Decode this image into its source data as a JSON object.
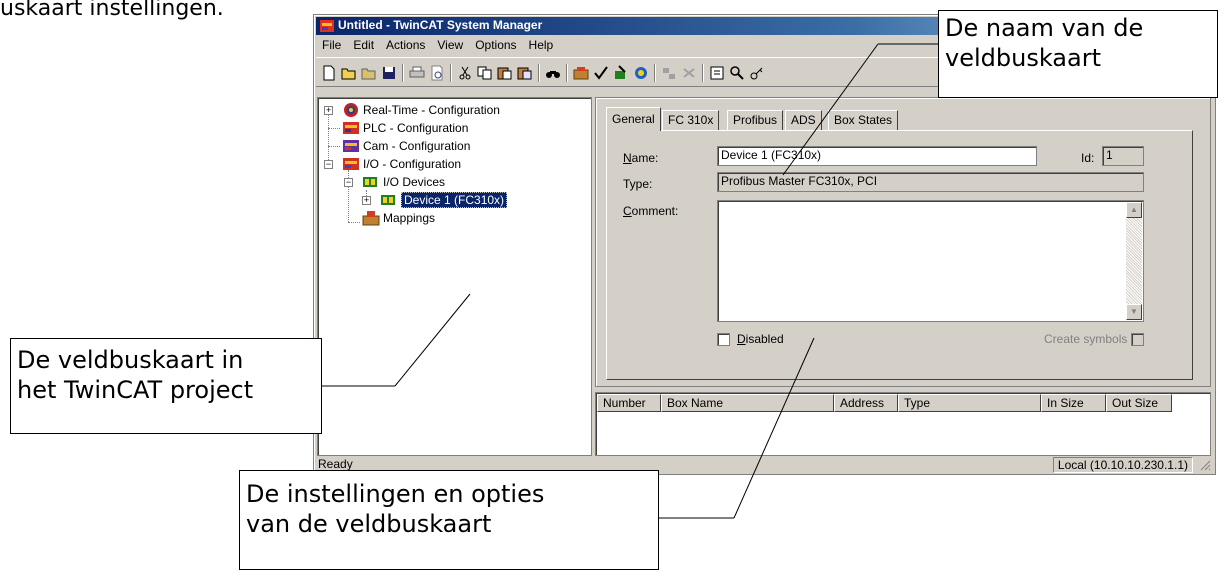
{
  "caption": "uskaart instellingen.",
  "window": {
    "title": "Untitled - TwinCAT System Manager",
    "menu": [
      "File",
      "Edit",
      "Actions",
      "View",
      "Options",
      "Help"
    ],
    "status_left": "Ready",
    "status_right": "Local (10.10.10.230.1.1)"
  },
  "tree": {
    "realtime": "Real-Time - Configuration",
    "plc": "PLC - Configuration",
    "cam": "Cam - Configuration",
    "io": "I/O - Configuration",
    "io_devices": "I/O Devices",
    "device1": "Device 1 (FC310x)",
    "mappings": "Mappings"
  },
  "tabs": [
    "General",
    "FC 310x",
    "Profibus",
    "ADS",
    "Box States"
  ],
  "general": {
    "name_label": "Name:",
    "name_value": "Device 1 (FC310x)",
    "id_label": "Id:",
    "id_value": "1",
    "type_label": "Type:",
    "type_value": "Profibus Master FC310x, PCI",
    "comment_label": "Comment:",
    "comment_value": "",
    "disabled_label": "Disabled",
    "create_symbols_label": "Create symbols"
  },
  "list_columns": [
    "Number",
    "Box Name",
    "Address",
    "Type",
    "In Size",
    "Out Size"
  ],
  "callouts": {
    "name_line1": "De naam van de",
    "name_line2": "veldbuskaart",
    "tree_line1": "De veldbuskaart in",
    "tree_line2": "het TwinCAT project",
    "settings_line1": "De instellingen en opties",
    "settings_line2": "van de veldbuskaart"
  },
  "colors": {
    "titlebar": "#0a246a",
    "face": "#d4d0c8",
    "selection": "#0a246a"
  }
}
